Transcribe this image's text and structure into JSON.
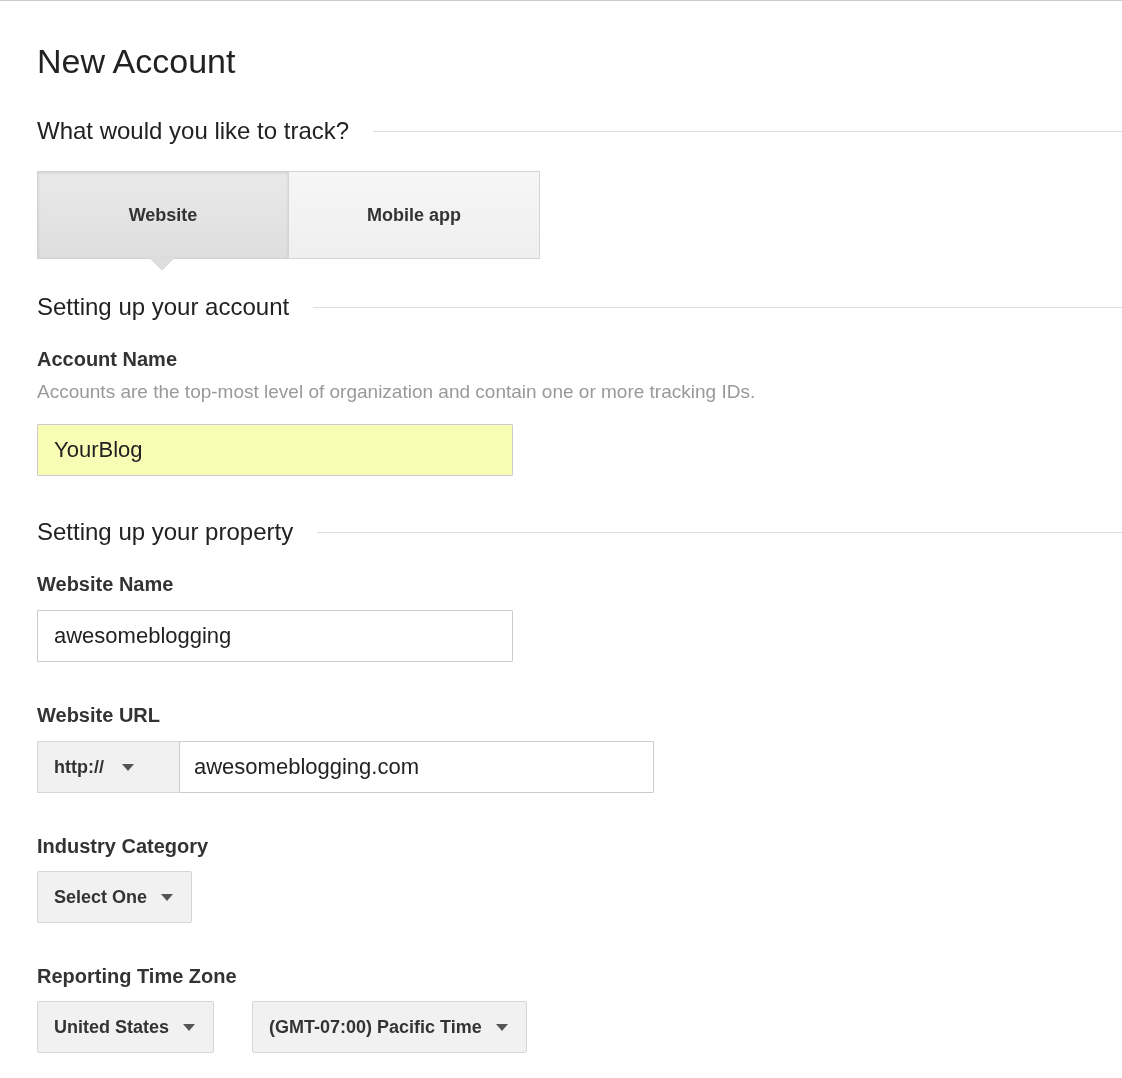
{
  "page": {
    "title": "New Account"
  },
  "track": {
    "heading": "What would you like to track?",
    "tabs": [
      {
        "label": "Website",
        "selected": true
      },
      {
        "label": "Mobile app",
        "selected": false
      }
    ]
  },
  "sections": [
    {
      "heading": "Setting up your account",
      "fields": [
        {
          "kind": "text",
          "label": "Account Name",
          "description": "Accounts are the top-most level of organization and contain one or more tracking IDs.",
          "value": "YourBlog",
          "highlighted": true
        }
      ]
    },
    {
      "heading": "Setting up your property",
      "fields": [
        {
          "kind": "text",
          "label": "Website Name",
          "value": "awesomeblogging",
          "highlighted": false
        },
        {
          "kind": "url",
          "label": "Website URL",
          "protocol": "http://",
          "value": "awesomeblogging.com"
        },
        {
          "kind": "selects",
          "label": "Industry Category",
          "selects": [
            "Select One"
          ]
        },
        {
          "kind": "selects",
          "label": "Reporting Time Zone",
          "selects": [
            "United States",
            "(GMT-07:00) Pacific Time"
          ]
        }
      ]
    }
  ]
}
